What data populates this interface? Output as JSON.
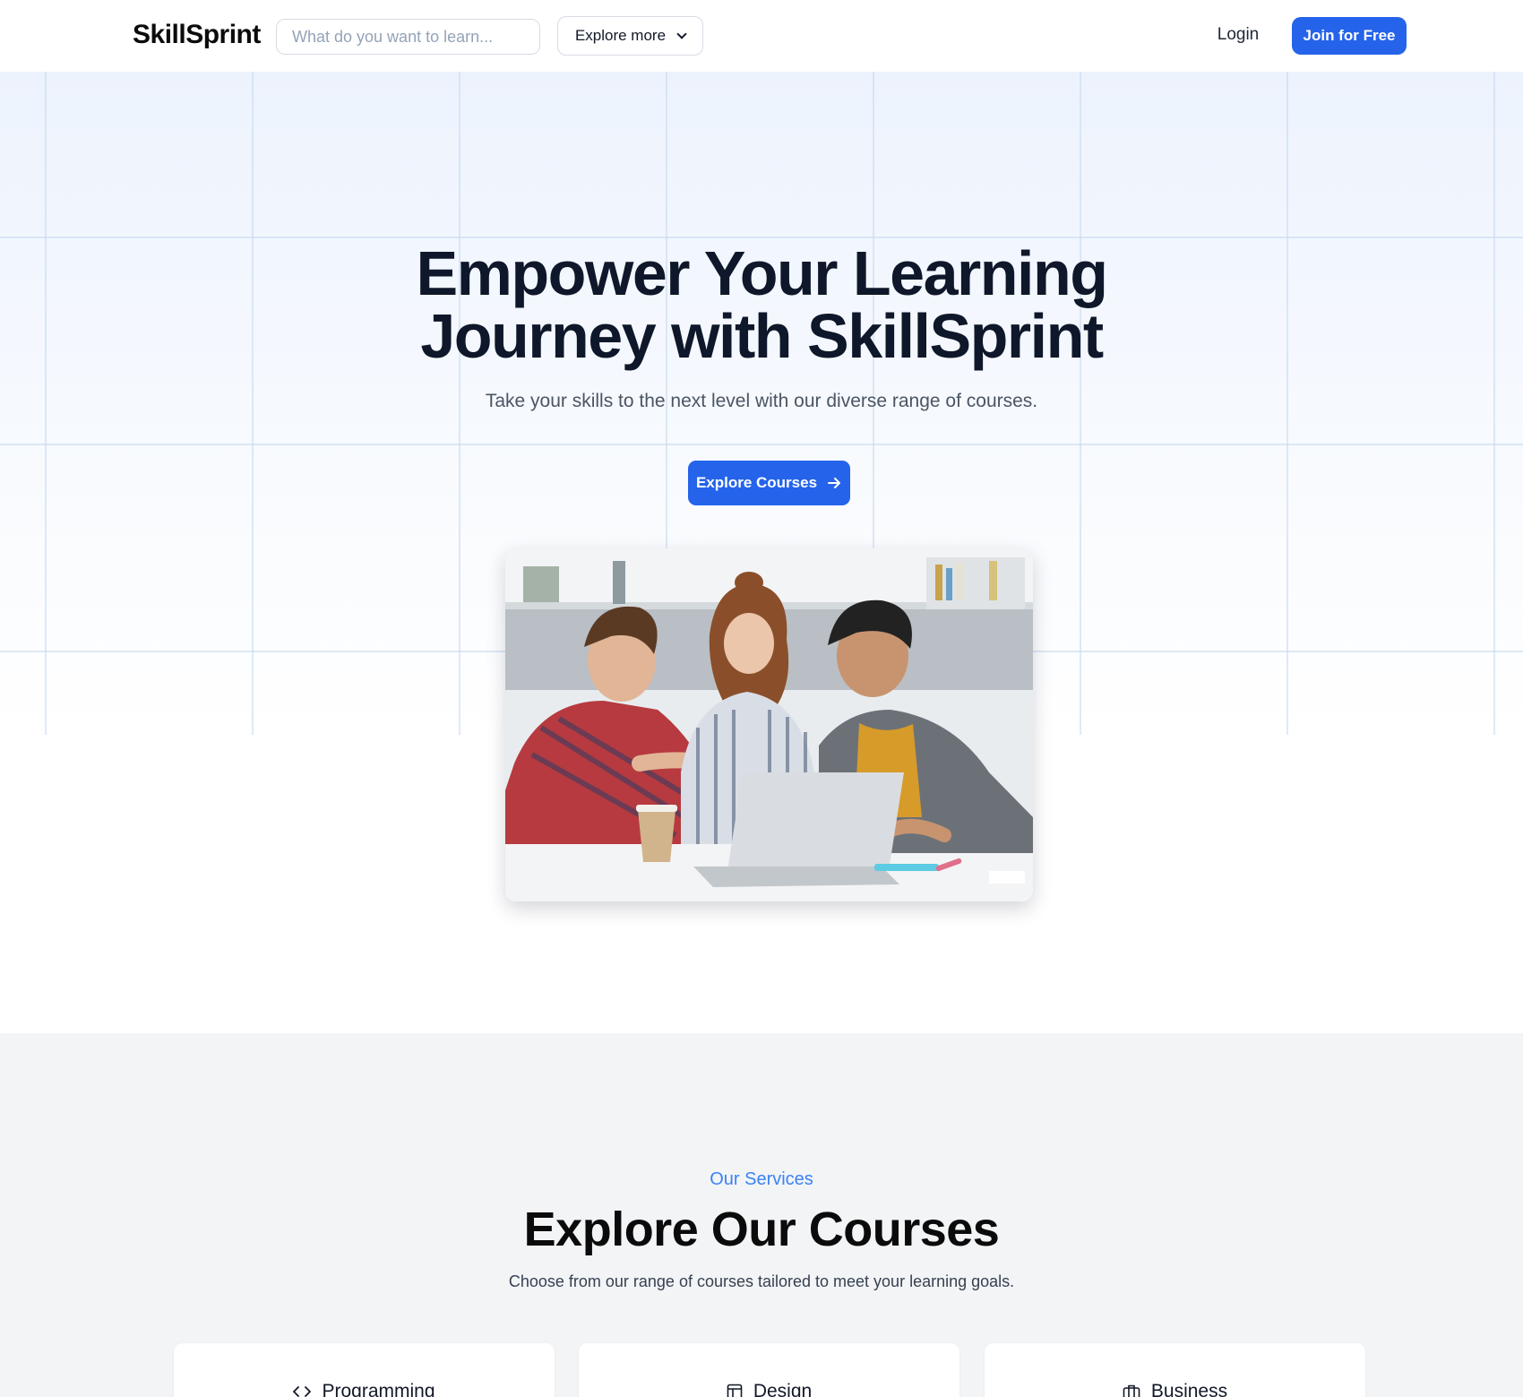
{
  "nav": {
    "logo": "SkillSprint",
    "search_placeholder": "What do you want to learn...",
    "explore_label": "Explore more",
    "login_label": "Login",
    "join_label": "Join for Free"
  },
  "hero": {
    "title_line1": "Empower Your Learning",
    "title_line2": "Journey with SkillSprint",
    "subtitle": "Take your skills to the next level with our diverse range of courses.",
    "cta_label": "Explore Courses"
  },
  "services": {
    "eyebrow": "Our Services",
    "title": "Explore Our Courses",
    "subtitle": "Choose from our range of courses tailored to meet your learning goals.",
    "cards": [
      {
        "label": "Programming",
        "icon": "code-icon"
      },
      {
        "label": "Design",
        "icon": "layout-icon"
      },
      {
        "label": "Business",
        "icon": "briefcase-icon"
      }
    ]
  },
  "colors": {
    "accent": "#2563eb",
    "eyebrow": "#3b82f6",
    "services_bg": "#f2f4f6"
  }
}
